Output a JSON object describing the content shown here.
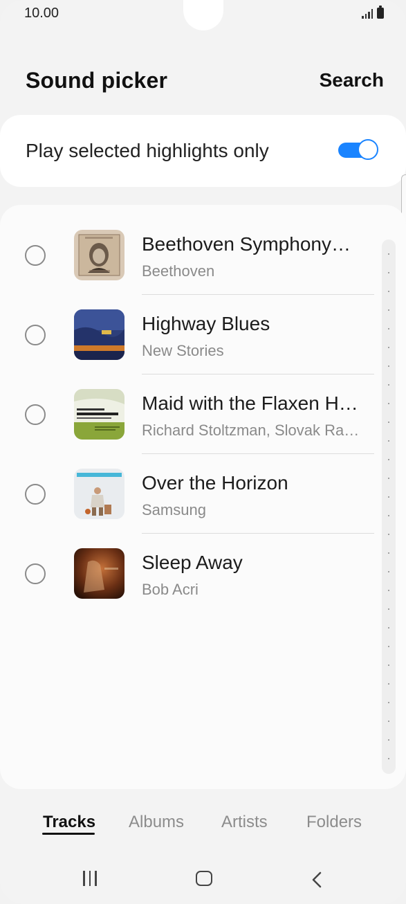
{
  "status_bar": {
    "time": "10.00"
  },
  "header": {
    "title": "Sound picker",
    "search_label": "Search"
  },
  "toggle": {
    "label": "Play selected highlights only",
    "on": true,
    "accent_color": "#1a84ff"
  },
  "tracks": [
    {
      "title": "Beethoven Symphony…",
      "artist": "Beethoven",
      "art_icon": "beethoven-album-art"
    },
    {
      "title": "Highway Blues",
      "artist": "New Stories",
      "art_icon": "highway-blues-album-art"
    },
    {
      "title": "Maid with the Flaxen H…",
      "artist": "Richard Stoltzman, Slovak Ra…",
      "art_icon": "maid-flaxen-album-art"
    },
    {
      "title": "Over the Horizon",
      "artist": "Samsung",
      "art_icon": "over-horizon-album-art"
    },
    {
      "title": "Sleep Away",
      "artist": "Bob Acri",
      "art_icon": "sleep-away-album-art"
    }
  ],
  "tabs": [
    {
      "label": "Tracks",
      "active": true
    },
    {
      "label": "Albums",
      "active": false
    },
    {
      "label": "Artists",
      "active": false
    },
    {
      "label": "Folders",
      "active": false
    }
  ],
  "nav_icons": [
    "recent-apps-icon",
    "home-icon",
    "back-icon"
  ]
}
